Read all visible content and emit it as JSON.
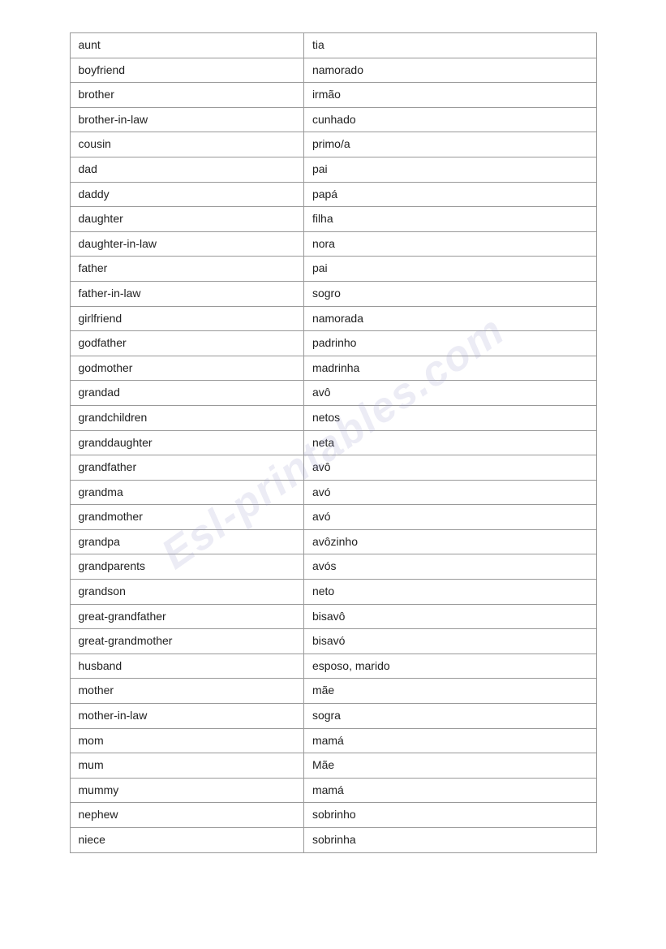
{
  "watermark": "Esl-printables.com",
  "table": {
    "rows": [
      {
        "english": "aunt",
        "portuguese": "tia"
      },
      {
        "english": "boyfriend",
        "portuguese": "namorado"
      },
      {
        "english": "brother",
        "portuguese": "irmão"
      },
      {
        "english": "brother-in-law",
        "portuguese": "cunhado"
      },
      {
        "english": "cousin",
        "portuguese": "primo/a"
      },
      {
        "english": "dad",
        "portuguese": "pai"
      },
      {
        "english": "daddy",
        "portuguese": "papá"
      },
      {
        "english": "daughter",
        "portuguese": "filha"
      },
      {
        "english": "daughter-in-law",
        "portuguese": "nora"
      },
      {
        "english": "father",
        "portuguese": "pai"
      },
      {
        "english": "father-in-law",
        "portuguese": "sogro"
      },
      {
        "english": "girlfriend",
        "portuguese": "namorada"
      },
      {
        "english": "godfather",
        "portuguese": "padrinho"
      },
      {
        "english": "godmother",
        "portuguese": "madrinha"
      },
      {
        "english": "grandad",
        "portuguese": "avô"
      },
      {
        "english": "grandchildren",
        "portuguese": "netos"
      },
      {
        "english": "granddaughter",
        "portuguese": "neta"
      },
      {
        "english": "grandfather",
        "portuguese": "avô"
      },
      {
        "english": "grandma",
        "portuguese": "avó"
      },
      {
        "english": "grandmother",
        "portuguese": "avó"
      },
      {
        "english": "grandpa",
        "portuguese": "avôzinho"
      },
      {
        "english": "grandparents",
        "portuguese": "avós"
      },
      {
        "english": "grandson",
        "portuguese": "neto"
      },
      {
        "english": "great-grandfather",
        "portuguese": "bisavô"
      },
      {
        "english": "great-grandmother",
        "portuguese": "bisavó"
      },
      {
        "english": "husband",
        "portuguese": "esposo, marido"
      },
      {
        "english": "mother",
        "portuguese": "mãe"
      },
      {
        "english": "mother-in-law",
        "portuguese": "sogra"
      },
      {
        "english": "mom",
        "portuguese": "mamá"
      },
      {
        "english": "mum",
        "portuguese": "Mãe"
      },
      {
        "english": "mummy",
        "portuguese": "mamá"
      },
      {
        "english": "nephew",
        "portuguese": "sobrinho"
      },
      {
        "english": "niece",
        "portuguese": "sobrinha"
      }
    ]
  }
}
